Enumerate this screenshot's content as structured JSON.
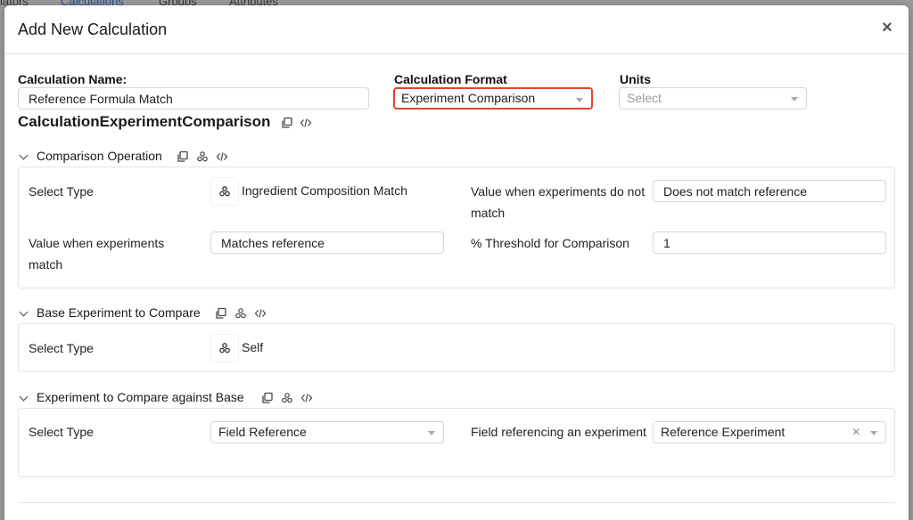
{
  "background_tabs": [
    "iators",
    "Calculations",
    "Groups",
    "Attributes"
  ],
  "modal": {
    "title": "Add New Calculation",
    "close_label": "×"
  },
  "calculation_name": {
    "label": "Calculation Name:",
    "value": "Reference Formula Match"
  },
  "calculation_format": {
    "label": "Calculation Format",
    "value": "Experiment Comparison"
  },
  "units": {
    "label": "Units",
    "placeholder": "Select"
  },
  "calc_identifier": "CalculationExperimentComparison",
  "sections": {
    "comparison_operation": {
      "title": "Comparison Operation",
      "select_type_label": "Select Type",
      "select_type_value": "Ingredient Composition Match",
      "no_match_label": "Value when experiments do not match",
      "no_match_value": "Does not match reference",
      "match_label": "Value when experiments match",
      "match_value": "Matches reference",
      "threshold_label": "% Threshold for Comparison",
      "threshold_value": "1"
    },
    "base_experiment": {
      "title": "Base Experiment to Compare",
      "select_type_label": "Select Type",
      "select_type_value": "Self"
    },
    "compare_against": {
      "title": "Experiment to Compare against Base",
      "select_type_label": "Select Type",
      "select_type_value": "Field Reference",
      "field_label": "Field referencing an experiment",
      "field_value": "Reference Experiment",
      "clear_label": "×"
    }
  },
  "colors": {
    "highlight_border": "#e0462c",
    "backdrop": "#9a9a9a"
  }
}
